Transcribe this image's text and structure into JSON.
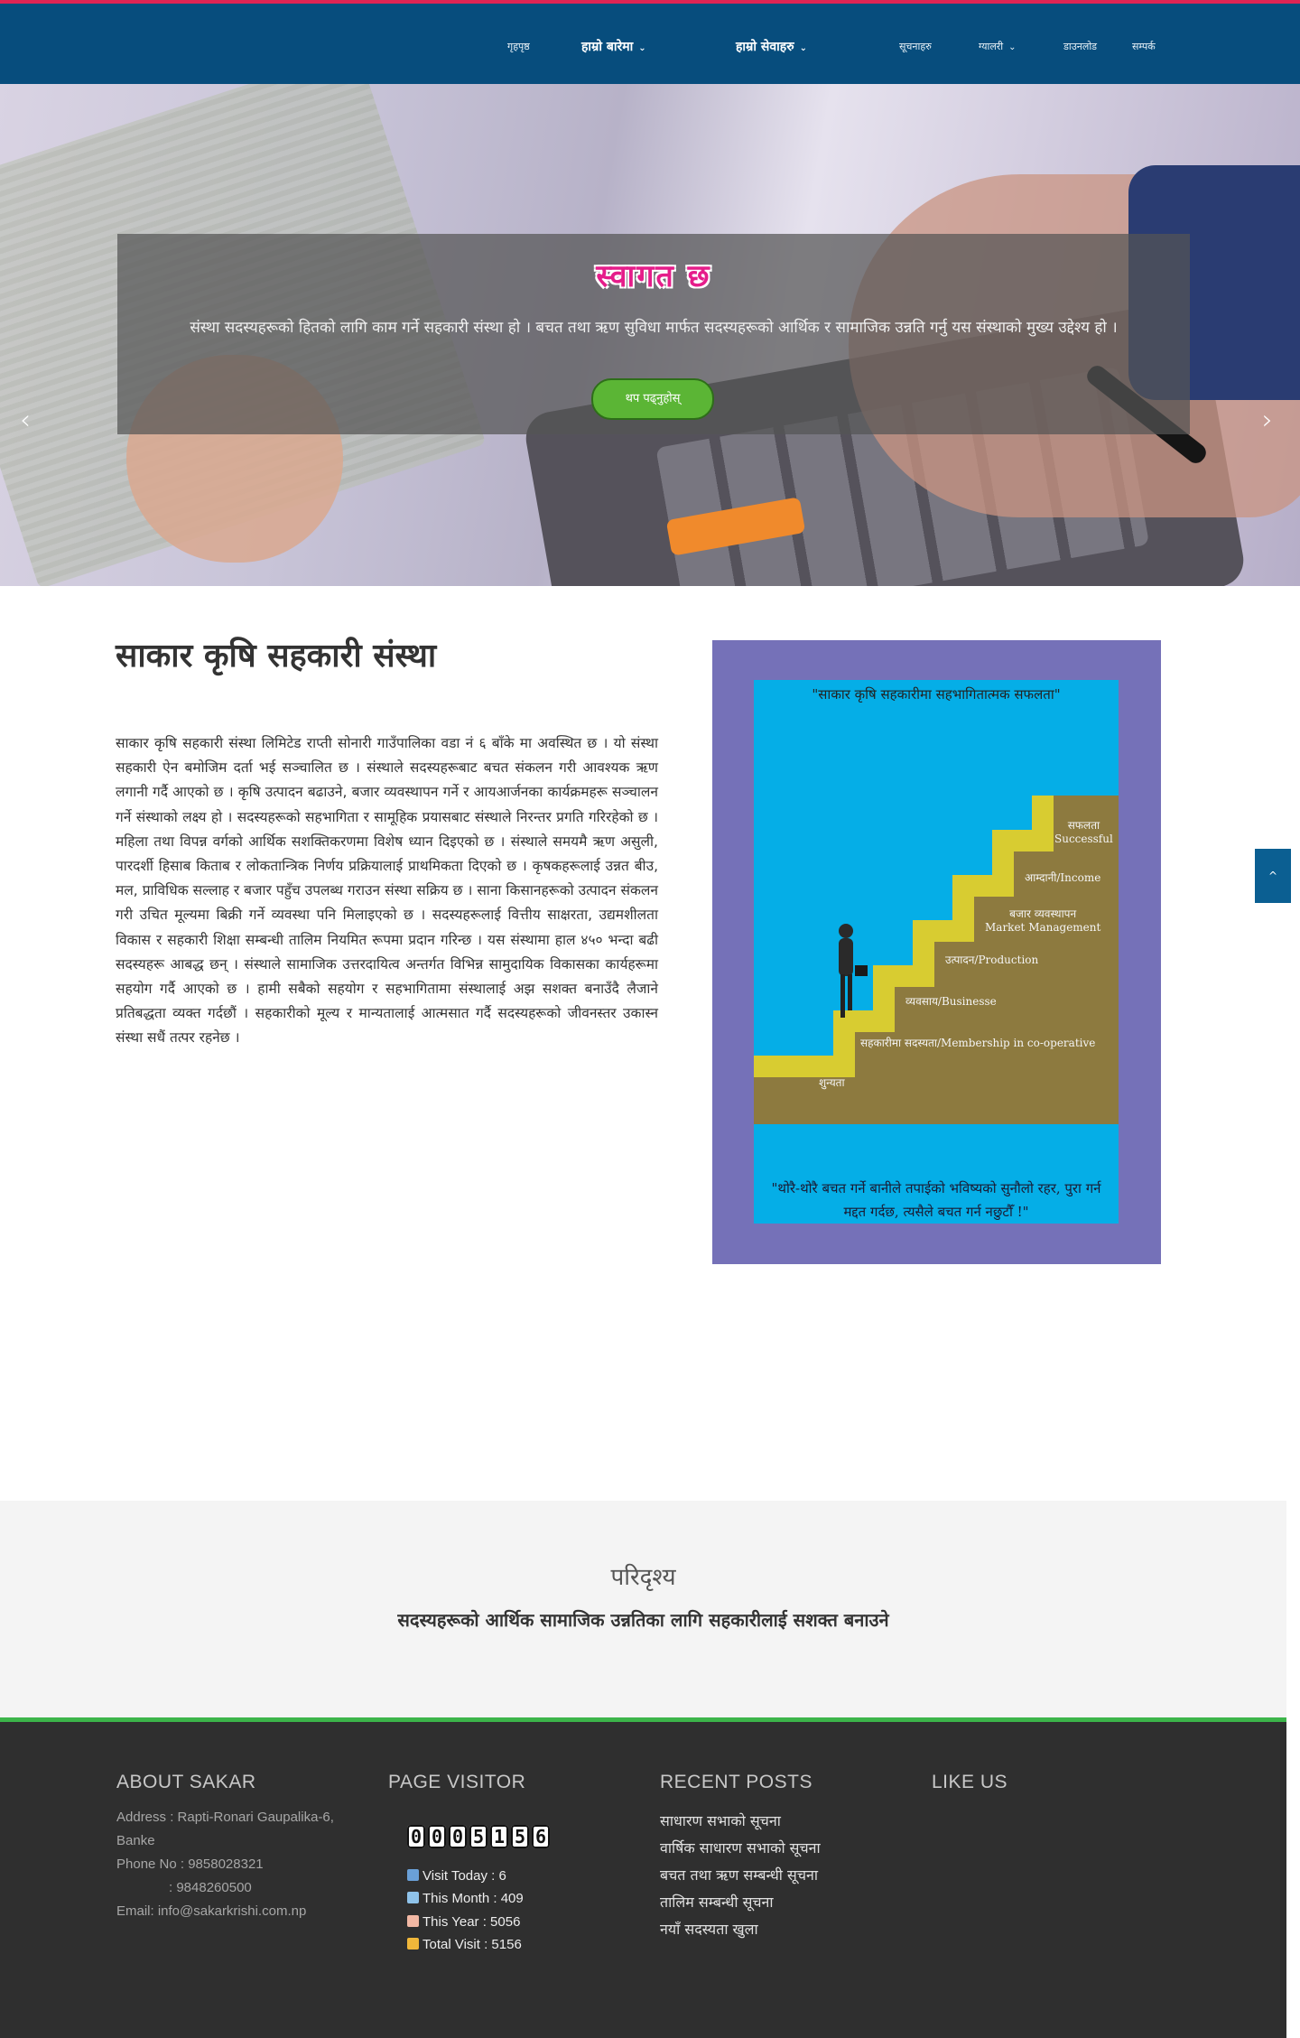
{
  "nav": {
    "items": [
      {
        "label": "गृहपृष्ठ",
        "dropdown": false,
        "bold": false
      },
      {
        "label": "हाम्रो बारेमा",
        "dropdown": true,
        "bold": true
      },
      {
        "label": "हाम्रो सेवाहरु",
        "dropdown": true,
        "bold": true
      },
      {
        "label": "सूचनाहरु",
        "dropdown": false,
        "bold": false
      },
      {
        "label": "ग्यालरी",
        "dropdown": true,
        "bold": false
      },
      {
        "label": "डाउनलोड",
        "dropdown": false,
        "bold": false
      },
      {
        "label": "सम्पर्क",
        "dropdown": false,
        "bold": false
      }
    ]
  },
  "hero": {
    "title": "स्वागत छ",
    "text": "संस्था सदस्यहरूको हितको लागि काम गर्ने सहकारी संस्था हो । बचत तथा ऋण सुविधा मार्फत सदस्यहरूको आर्थिक र सामाजिक उन्नति गर्नु यस संस्थाको मुख्य उद्देश्य हो ।",
    "button": "थप पढ्नुहोस्",
    "prev_arrow": "‹",
    "next_arrow": "›"
  },
  "about": {
    "title": "साकार कृषि सहकारी संस्था",
    "body": "साकार कृषि सहकारी संस्था लिमिटेड राप्ती सोनारी गाउँपालिका वडा नं ६ बाँके मा अवस्थित छ । यो संस्था सहकारी ऐन बमोजिम दर्ता भई सञ्चालित छ । संस्थाले सदस्यहरूबाट बचत संकलन गरी आवश्यक ऋण लगानी गर्दै आएको छ । कृषि उत्पादन बढाउने, बजार व्यवस्थापन गर्ने र आयआर्जनका कार्यक्रमहरू सञ्चालन गर्ने संस्थाको लक्ष्य हो । सदस्यहरूको सहभागिता र सामूहिक प्रयासबाट संस्थाले निरन्तर प्रगति गरिरहेको छ । महिला तथा विपन्न वर्गको आर्थिक सशक्तिकरणमा विशेष ध्यान दिइएको छ । संस्थाले समयमै ऋण असुली, पारदर्शी हिसाब किताब र लोकतान्त्रिक निर्णय प्रक्रियालाई प्राथमिकता दिएको छ । कृषकहरूलाई उन्नत बीउ, मल, प्राविधिक सल्लाह र बजार पहुँच उपलब्ध गराउन संस्था सक्रिय छ । साना किसानहरूको उत्पादन संकलन गरी उचित मूल्यमा बिक्री गर्ने व्यवस्था पनि मिलाइएको छ । सदस्यहरूलाई वित्तीय साक्षरता, उद्यमशीलता विकास र सहकारी शिक्षा सम्बन्धी तालिम नियमित रूपमा प्रदान गरिन्छ । यस संस्थामा हाल ४५० भन्दा बढी सदस्यहरू आबद्ध छन् । संस्थाले सामाजिक उत्तरदायित्व अन्तर्गत विभिन्न सामुदायिक विकासका कार्यहरूमा सहयोग गर्दै आएको छ । हामी सबैको सहयोग र सहभागितामा संस्थालाई अझ सशक्त बनाउँदै लैजाने प्रतिबद्धता व्यक्त गर्दछौं । सहकारीको मूल्य र मान्यतालाई आत्मसात गर्दै सदस्यहरूको जीवनस्तर उकास्न संस्था सधैं तत्पर रहनेछ ।"
  },
  "poster": {
    "top_quote": "\"साकार कृषि सहकारीमा सहभागितात्मक सफलता\"",
    "bottom_quote": "\"थोरै-थोरै बचत गर्ने बानीले तपाईको भविष्यको सुनौलो रहर, पुरा गर्न मद्दत गर्दछ, त्यसैले बचत गर्न नछुटौँ !\"",
    "labels": [
      {
        "text": "सफलता",
        "sub": "Successful"
      },
      {
        "text": "आम्दानी/Income",
        "sub": ""
      },
      {
        "text": "बजार व्यवस्थापन",
        "sub": "Market Management"
      },
      {
        "text": "उत्पादन/Production",
        "sub": ""
      },
      {
        "text": "व्यवसाय/Businesse",
        "sub": ""
      },
      {
        "text": "सहकारीमा सदस्यता/Membership in co-operative",
        "sub": ""
      },
      {
        "text": "शुन्यता",
        "sub": ""
      }
    ],
    "colors": {
      "frame": "#7571b8",
      "sky": "#05aee7",
      "stairs": "#d8cc31",
      "ground": "#8d7a3f"
    }
  },
  "scroll_top": {
    "icon": "chevron-up-icon",
    "label": "^"
  },
  "vision": {
    "title": "परिदृश्य",
    "text": "सदस्यहरूको आर्थिक सामाजिक उन्नतिका लागि सहकारीलाई सशक्त बनाउने"
  },
  "footer": {
    "about": {
      "title": "ABOUT SAKAR",
      "address_1": "Address : Rapti-Ronari Gaupalika-6,",
      "address_2": "Banke",
      "phone_1": "Phone No : 9858028321",
      "phone_2": ": 9848260500",
      "email": "Email: info@sakarkrishi.com.np"
    },
    "visitor": {
      "title": "PAGE VISITOR",
      "digits": [
        "0",
        "0",
        "0",
        "5",
        "1",
        "5",
        "6"
      ],
      "today": "Visit Today : 6",
      "month": "This Month : 409",
      "year": "This Year : 5056",
      "total": "Total Visit : 5156"
    },
    "posts": {
      "title": "RECENT POSTS",
      "items": [
        "साधारण सभाको सूचना",
        "वार्षिक साधारण सभाको सूचना",
        "बचत तथा ऋण सम्बन्धी सूचना",
        "तालिम सम्बन्धी सूचना",
        "नयाँ सदस्यता खुला"
      ]
    },
    "like": {
      "title": "LIKE US"
    }
  }
}
